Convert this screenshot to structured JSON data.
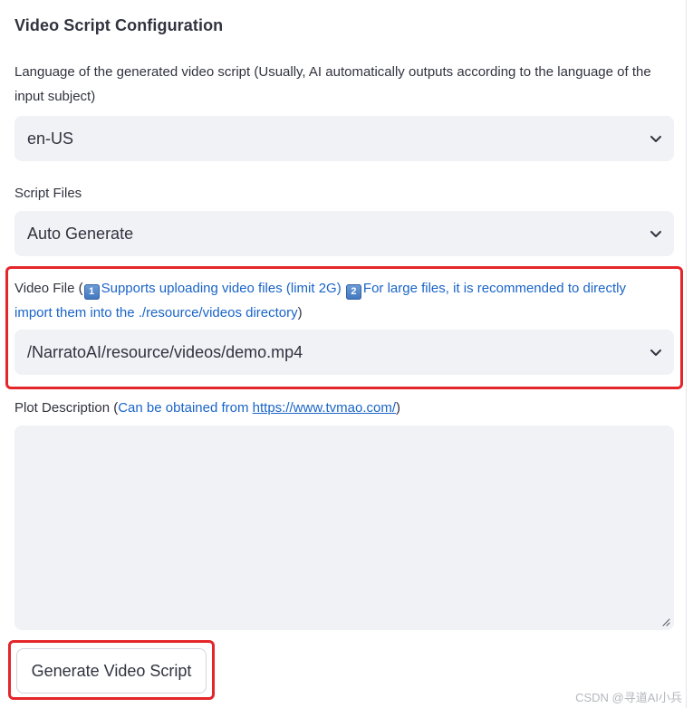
{
  "section": {
    "title": "Video Script Configuration"
  },
  "language": {
    "label": "Language of the generated video script (Usually, AI automatically outputs according to the language of the input subject)",
    "value": "en-US"
  },
  "script_files": {
    "label": "Script Files",
    "value": "Auto Generate"
  },
  "video_file": {
    "label_prefix": "Video File (",
    "num1": "1",
    "tip1": "Supports uploading video files (limit 2G)",
    "num2": "2",
    "tip2": "For large files, it is recommended to directly import them into the ./resource/videos directory",
    "label_suffix": ")",
    "value": "/NarratoAI/resource/videos/demo.mp4"
  },
  "plot_description": {
    "label_prefix": "Plot Description (",
    "hint": "Can be obtained from ",
    "link": "https://www.tvmao.com/",
    "label_suffix": ")",
    "value": ""
  },
  "actions": {
    "generate_label": "Generate Video Script"
  },
  "watermark": "CSDN @寻道AI小兵",
  "colors": {
    "accent_blue": "#1a64c8",
    "highlight_red": "#e4262b",
    "field_bg": "#f0f2f6"
  },
  "icons": {
    "dropdown": "chevron-down-icon",
    "textarea_grip": "resize-grip-icon"
  }
}
